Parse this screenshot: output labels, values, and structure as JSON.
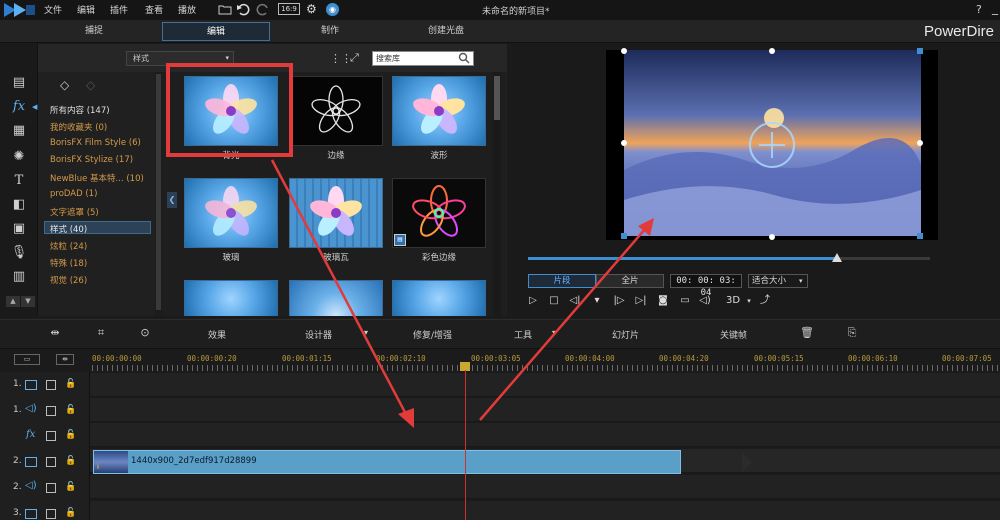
{
  "menu": {
    "items": [
      "文件",
      "编辑",
      "插件",
      "查看",
      "播放"
    ]
  },
  "window": {
    "project_title": "未命名的新项目*",
    "help": "?",
    "minimize": "_"
  },
  "toolbar": {
    "ratio": "16:9"
  },
  "modes": {
    "capture": "捕捉",
    "edit": "编辑",
    "produce": "制作",
    "disc": "创建光盘",
    "brand": "PowerDire"
  },
  "library": {
    "dropdown": "样式",
    "search_placeholder": "搜索库",
    "categories": [
      "所有内容 (147)",
      "我的收藏夹  (0)",
      "BorisFX Film Style  (6)",
      "BorisFX Stylize  (17)",
      "NewBlue 基本特...  (10)",
      "proDAD  (1)",
      "文字遮罩  (5)",
      "样式  (40)",
      "炫粒  (24)",
      "特殊  (18)",
      "视觉  (26)"
    ],
    "effects": [
      "背光",
      "边缘",
      "波形",
      "玻璃",
      "玻璃瓦",
      "彩色边缘"
    ]
  },
  "preview": {
    "clip_btn": "片段",
    "movie_btn": "全片",
    "timecode": "00: 00: 03: 04",
    "fit": "适合大小",
    "mode3d": "3D"
  },
  "timeline_toolbar": {
    "effect": "效果",
    "designer": "设计器",
    "repair": "修复/增强",
    "tools": "工具",
    "slideshow": "幻灯片",
    "keyframe": "关键帧"
  },
  "ruler": {
    "labels": [
      "00:00:00:00",
      "00:00:00:20",
      "00:00:01:15",
      "00:00:02:10",
      "00:00:03:05",
      "00:00:04:00",
      "00:00:04:20",
      "00:00:05:15",
      "00:00:06:10",
      "00:00:07:05"
    ]
  },
  "tracks": [
    {
      "num": "1.",
      "kind": "video"
    },
    {
      "num": "1.",
      "kind": "audio"
    },
    {
      "num": "fx",
      "kind": "fx"
    },
    {
      "num": "2.",
      "kind": "video"
    },
    {
      "num": "2.",
      "kind": "audio"
    },
    {
      "num": "3.",
      "kind": "video"
    }
  ],
  "clip": {
    "label": "1440x900_2d7edf917d28899"
  },
  "colors": {
    "accent": "#3e8ed0",
    "highlight": "#e23b3b",
    "category_text": "#d49a4a",
    "clip": "#5a9fc8"
  }
}
